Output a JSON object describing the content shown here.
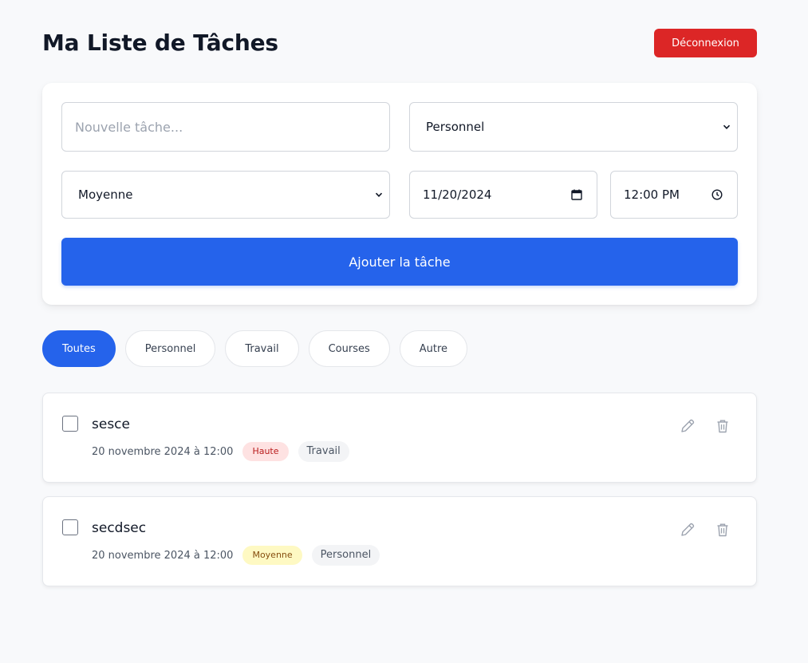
{
  "header": {
    "title": "Ma Liste de Tâches",
    "logout_label": "Déconnexion"
  },
  "form": {
    "task_placeholder": "Nouvelle tâche...",
    "task_value": "",
    "category_selected": "Personnel",
    "priority_selected": "Moyenne",
    "date_value": "11/20/2024",
    "time_value": "12:00 PM",
    "add_label": "Ajouter la tâche"
  },
  "filters": [
    {
      "label": "Toutes",
      "active": true
    },
    {
      "label": "Personnel",
      "active": false
    },
    {
      "label": "Travail",
      "active": false
    },
    {
      "label": "Courses",
      "active": false
    },
    {
      "label": "Autre",
      "active": false
    }
  ],
  "tasks": [
    {
      "title": "sesce",
      "datetime": "20 novembre 2024 à 12:00",
      "priority": "Haute",
      "priority_level": "high",
      "category": "Travail",
      "completed": false
    },
    {
      "title": "secdsec",
      "datetime": "20 novembre 2024 à 12:00",
      "priority": "Moyenne",
      "priority_level": "medium",
      "category": "Personnel",
      "completed": false
    }
  ],
  "icons": {
    "edit": "pencil-icon",
    "delete": "trash-icon",
    "calendar": "calendar-icon",
    "clock": "clock-icon",
    "chevron": "chevron-down-icon"
  },
  "colors": {
    "primary": "#2563eb",
    "danger": "#dc2626",
    "high_badge_bg": "#fee2e2",
    "medium_badge_bg": "#fef9c3"
  }
}
